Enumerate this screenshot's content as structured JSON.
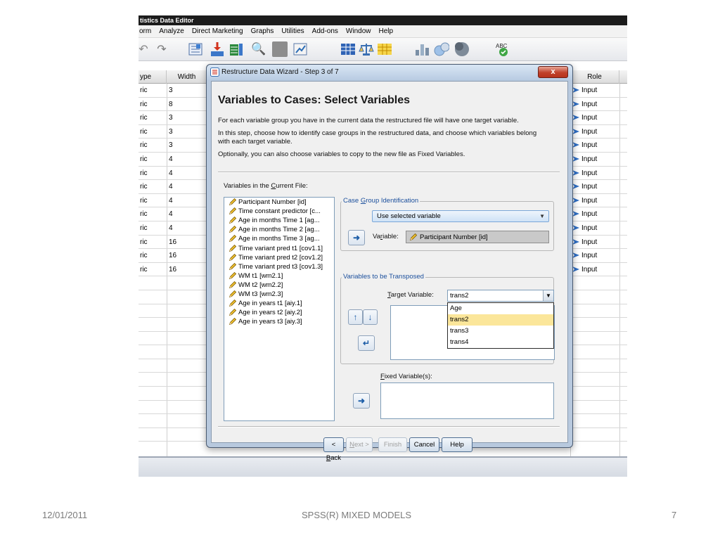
{
  "app": {
    "title": "tistics Data Editor",
    "menu": [
      "orm",
      "Analyze",
      "Direct Marketing",
      "Graphs",
      "Utilities",
      "Add-ons",
      "Window",
      "Help"
    ],
    "toolbar_icons": [
      "undo-icon",
      "redo-icon",
      "goto-case-icon",
      "insert-case-icon",
      "insert-variable-icon",
      "find-icon",
      "split-file-icon",
      "weight-cases-icon",
      "select-cases-icon",
      "value-labels-icon",
      "use-sets-icon",
      "chart-icon",
      "scatter-icon",
      "spell-check-icon"
    ],
    "grid": {
      "headers": {
        "type": "ype",
        "width": "Width",
        "role": "Role"
      },
      "rows": [
        {
          "type": "ric",
          "width": "3",
          "role": "Input"
        },
        {
          "type": "ric",
          "width": "8",
          "role": "Input"
        },
        {
          "type": "ric",
          "width": "3",
          "role": "Input"
        },
        {
          "type": "ric",
          "width": "3",
          "role": "Input"
        },
        {
          "type": "ric",
          "width": "3",
          "role": "Input"
        },
        {
          "type": "ric",
          "width": "4",
          "role": "Input"
        },
        {
          "type": "ric",
          "width": "4",
          "role": "Input"
        },
        {
          "type": "ric",
          "width": "4",
          "role": "Input"
        },
        {
          "type": "ric",
          "width": "4",
          "role": "Input"
        },
        {
          "type": "ric",
          "width": "4",
          "role": "Input"
        },
        {
          "type": "ric",
          "width": "4",
          "role": "Input"
        },
        {
          "type": "ric",
          "width": "16",
          "role": "Input"
        },
        {
          "type": "ric",
          "width": "16",
          "role": "Input"
        },
        {
          "type": "ric",
          "width": "16",
          "role": "Input"
        }
      ],
      "empty_rows": 12
    }
  },
  "dialog": {
    "title": "Restructure Data Wizard - Step 3 of 7",
    "close_label": "x",
    "heading": "Variables to Cases: Select Variables",
    "para1": "For each variable group you have in the current data the restructured file will have one target variable.",
    "para2": "In this step, choose how to identify case groups in the restructured data, and choose which variables belong with each target variable.",
    "para3": "Optionally, you can also choose variables to copy to the new file as Fixed Variables.",
    "vars_label": {
      "pre": "Variables in the ",
      "key": "C",
      "post": "urrent File:"
    },
    "variables": [
      "Participant Number [id]",
      "Time constant predictor [c...",
      "Age in months Time 1 [ag...",
      "Age in months Time 2 [ag...",
      "Age in months Time 3 [ag...",
      "Time variant pred t1 [cov1.1]",
      "Time variant pred t2 [cov1.2]",
      "Time variant pred t3 [cov1.3]",
      "WM t1 [wm2.1]",
      "WM t2 [wm2.2]",
      "WM t3 [wm2.3]",
      "Age in years t1 [aiy.1]",
      "Age in years t2 [aiy.2]",
      "Age in years t3 [aiy.3]"
    ],
    "case_group": {
      "caption": {
        "pre": "Case ",
        "key": "G",
        "post": "roup Identification"
      },
      "selected": "Use selected variable",
      "variable_label": {
        "pre": "Va",
        "key": "r",
        "post": "iable:"
      },
      "variable_value": "Participant Number [id]"
    },
    "transposed": {
      "caption": "Variables to be Transposed",
      "target_label": {
        "pre": "",
        "key": "T",
        "post": "arget Variable:"
      },
      "target_value": "trans2",
      "options": [
        "Age",
        "trans2",
        "trans3",
        "trans4"
      ],
      "selected_index": 1
    },
    "fixed": {
      "label": {
        "pre": "",
        "key": "F",
        "post": "ixed Variable(s):"
      }
    },
    "buttons": {
      "back": {
        "pre": "< ",
        "key": "B",
        "post": "ack"
      },
      "next": {
        "pre": "",
        "key": "N",
        "post": "ext >"
      },
      "finish": "Finish",
      "cancel": "Cancel",
      "help": "Help"
    }
  },
  "footer": {
    "date": "12/01/2011",
    "title": "SPSS(R) MIXED MODELS",
    "page": "7"
  }
}
